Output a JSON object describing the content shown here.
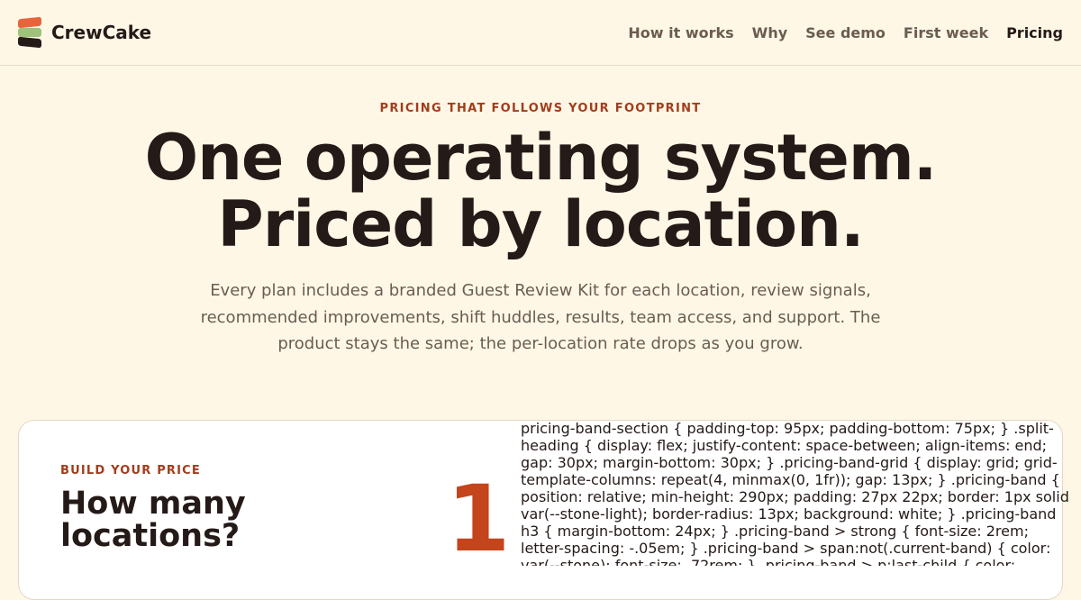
{
  "brand": {
    "name": "CrewCake",
    "logo_colors": [
      "#e8643a",
      "#9fc27a",
      "#241a17"
    ]
  },
  "nav": {
    "items": [
      {
        "label": "How it works",
        "current": false
      },
      {
        "label": "Why",
        "current": false
      },
      {
        "label": "See demo",
        "current": false
      },
      {
        "label": "First week",
        "current": false
      },
      {
        "label": "Pricing",
        "current": true
      }
    ]
  },
  "hero": {
    "eyebrow": "PRICING THAT FOLLOWS YOUR FOOTPRINT",
    "headline_line1": "One operating system.",
    "headline_line2": "Priced by location.",
    "subcopy": "Every plan includes a branded Guest Review Kit for each location, review signals, recommended improvements, shift huddles, results, team access, and support. The product stays the same; the per-location rate drops as you grow."
  },
  "builder": {
    "eyebrow": "BUILD YOUR PRICE",
    "title": "How many locations?",
    "count": "1"
  },
  "leaked_css_text": "pricing-band-section { padding-top: 95px; padding-bottom: 75px; } .split-heading { display: flex; justify-content: space-between; align-items: end; gap: 30px; margin-bottom: 30px; } .pricing-band-grid { display: grid; grid-template-columns: repeat(4, minmax(0, 1fr)); gap: 13px; } .pricing-band { position: relative; min-height: 290px; padding: 27px 22px; border: 1px solid var(--stone-light); border-radius: 13px; background: white; } .pricing-band h3 { margin-bottom: 24px; } .pricing-band > strong { font-size: 2rem; letter-spacing: -.05em; } .pricing-band > span:not(.current-band) { color: var(--stone); font-size: .72rem; } .pricing-band > p:last-child { color:",
  "colors": {
    "background": "#fff7e6",
    "accent": "#a13d1c",
    "count": "#c4441c",
    "ink": "#241a17",
    "muted": "#6a5c52"
  }
}
